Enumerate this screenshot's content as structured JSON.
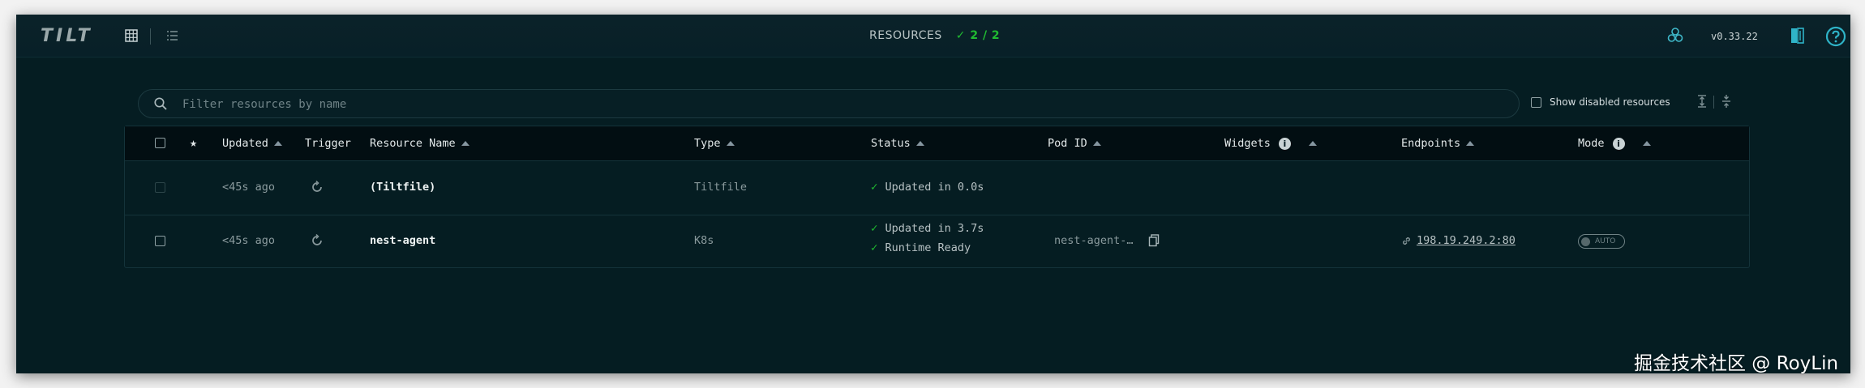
{
  "app": {
    "logo": "TILT",
    "version": "v0.33.22"
  },
  "header": {
    "resources_label": "RESOURCES",
    "resources_count": "2 / 2",
    "accent_color": "#20ba31"
  },
  "filter": {
    "placeholder": "Filter resources by name",
    "value": "",
    "show_disabled_label": "Show disabled resources"
  },
  "table": {
    "columns": [
      "Updated",
      "Trigger",
      "Resource Name",
      "Type",
      "Status",
      "Pod ID",
      "Widgets",
      "Endpoints",
      "Mode"
    ],
    "star_header": "★",
    "rows": [
      {
        "updated": "<45s ago",
        "name": "(Tiltfile)",
        "type": "Tiltfile",
        "status": [
          "Updated in 0.0s"
        ],
        "pod_id": "",
        "endpoint": "",
        "mode": ""
      },
      {
        "updated": "<45s ago",
        "name": "nest-agent",
        "type": "K8s",
        "status": [
          "Updated in 3.7s",
          "Runtime Ready"
        ],
        "pod_id": "nest-agent-…",
        "endpoint": "198.19.249.2:80",
        "mode": "AUTO"
      }
    ]
  },
  "icons": {
    "grid_view": "grid-icon",
    "list_view": "list-icon",
    "snapshot": "snapshot-icon",
    "docs": "book-icon",
    "help": "help-icon",
    "search": "search-icon",
    "trigger": "refresh-icon",
    "copy": "copy-icon",
    "link": "link-icon"
  },
  "watermark": "掘金技术社区 @ RoyLin"
}
